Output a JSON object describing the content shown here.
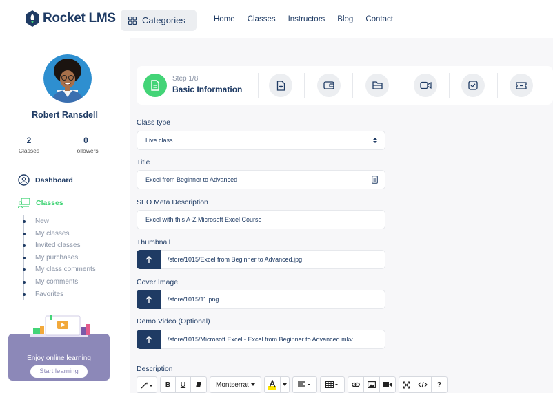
{
  "header": {
    "logo_text": "Rocket LMS",
    "categories_label": "Categories",
    "nav": [
      "Home",
      "Classes",
      "Instructors",
      "Blog",
      "Contact"
    ]
  },
  "sidebar": {
    "user_name": "Robert Ransdell",
    "stats": [
      {
        "value": "2",
        "label": "Classes"
      },
      {
        "value": "0",
        "label": "Followers"
      }
    ],
    "dashboard_label": "Dashboard",
    "classes_label": "Classes",
    "submenu": [
      "New",
      "My classes",
      "Invited classes",
      "My purchases",
      "My class comments",
      "My comments",
      "Favorites"
    ],
    "promo": {
      "text": "Enjoy online learning",
      "button": "Start learning"
    }
  },
  "steps": {
    "step_number": "Step 1/8",
    "step_title": "Basic Information",
    "icons": [
      "plus-file-icon",
      "wallet-icon",
      "folder-icon",
      "video-icon",
      "check-icon",
      "ticket-icon"
    ]
  },
  "form": {
    "class_type": {
      "label": "Class type",
      "value": "Live class"
    },
    "title": {
      "label": "Title",
      "value": "Excel from Beginner to Advanced"
    },
    "seo": {
      "label": "SEO Meta Description",
      "value": "Excel with this A-Z Microsoft Excel Course"
    },
    "thumbnail": {
      "label": "Thumbnail",
      "value": "/store/1015/Excel from Beginner to Advanced.jpg"
    },
    "cover": {
      "label": "Cover Image",
      "value": "/store/1015/11.png"
    },
    "demo": {
      "label": "Demo Video (Optional)",
      "value": "/store/1015/Microsoft Excel - Excel from Beginner to Advanced.mkv"
    },
    "description": {
      "label": "Description"
    }
  },
  "editor": {
    "bold": "B",
    "underline": "U",
    "font": "Montserrat",
    "help": "?"
  },
  "colors": {
    "primary": "#1f3b64",
    "accent": "#43d477",
    "promo": "#8c88b8"
  }
}
